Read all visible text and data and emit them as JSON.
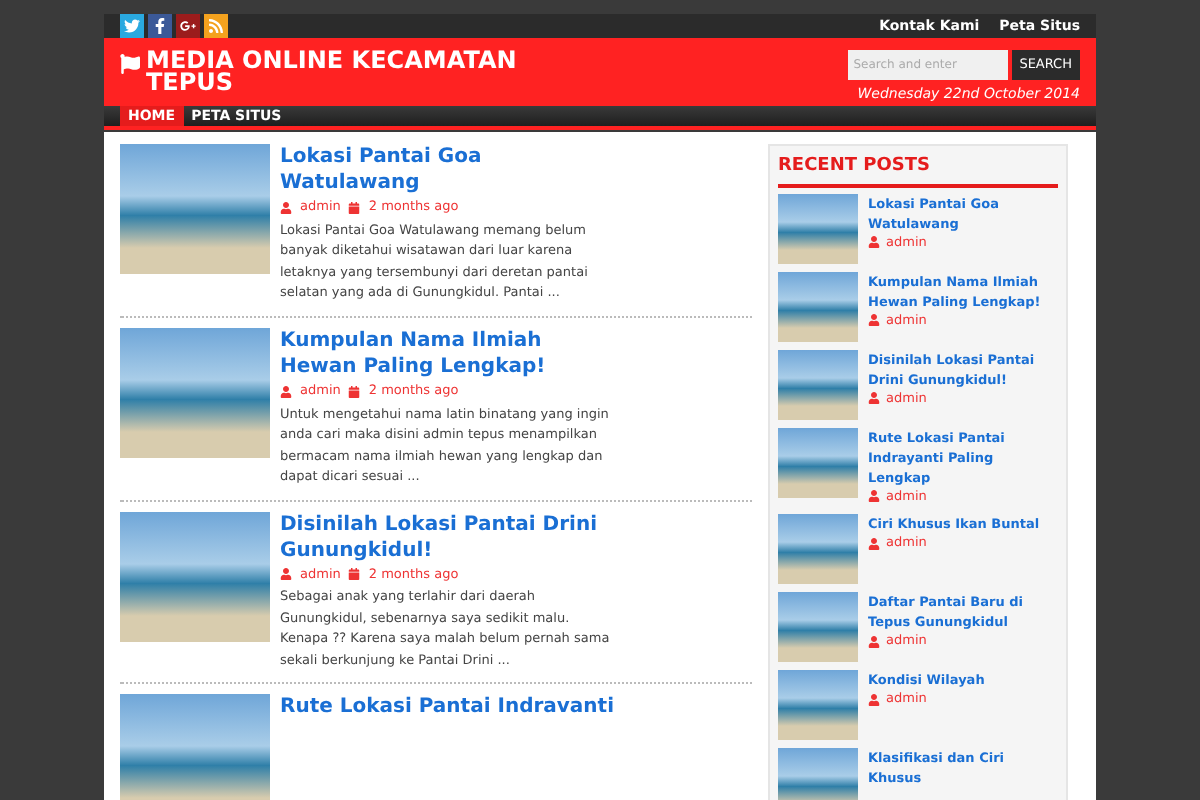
{
  "topbar": {
    "links": [
      "Kontak Kami",
      "Peta Situs"
    ]
  },
  "header": {
    "title": "MEDIA ONLINE KECAMATAN TEPUS",
    "search": {
      "placeholder": "Search and enter",
      "button": "SEARCH"
    },
    "date": "Wednesday 22nd October 2014"
  },
  "nav": [
    {
      "label": "HOME",
      "selected": true
    },
    {
      "label": "PETA SITUS",
      "selected": false
    }
  ],
  "posts": [
    {
      "title": "Lokasi Pantai Goa Watulawang",
      "author": "admin",
      "time": "2 months ago",
      "excerpt": "Lokasi Pantai Goa Watulawang memang belum banyak diketahui wisatawan dari luar karena letaknya yang tersembunyi dari deretan pantai selatan yang ada di Gunungkidul. Pantai ..."
    },
    {
      "title": "Kumpulan Nama Ilmiah Hewan Paling Lengkap!",
      "author": "admin",
      "time": "2 months ago",
      "excerpt": "Untuk mengetahui nama latin binatang yang ingin anda cari maka disini admin tepus menampilkan bermacam nama ilmiah hewan yang lengkap dan dapat dicari sesuai ..."
    },
    {
      "title": "Disinilah Lokasi Pantai Drini Gunungkidul!",
      "author": "admin",
      "time": "2 months ago",
      "excerpt": "Sebagai anak yang terlahir dari daerah Gunungkidul, sebenarnya saya sedikit malu. Kenapa ?? Karena saya malah belum pernah sama sekali berkunjung ke Pantai Drini ..."
    },
    {
      "title": "Rute Lokasi Pantai Indravanti"
    }
  ],
  "sidebar": {
    "title": "RECENT POSTS",
    "items": [
      {
        "title": "Lokasi Pantai Goa Watulawang",
        "author": "admin"
      },
      {
        "title": "Kumpulan Nama Ilmiah Hewan Paling Lengkap!",
        "author": "admin"
      },
      {
        "title": "Disinilah Lokasi Pantai Drini Gunungkidul!",
        "author": "admin"
      },
      {
        "title": "Rute Lokasi Pantai Indrayanti Paling Lengkap",
        "author": "admin"
      },
      {
        "title": "Ciri Khusus Ikan Buntal",
        "author": "admin"
      },
      {
        "title": "Daftar Pantai Baru di Tepus Gunungkidul",
        "author": "admin"
      },
      {
        "title": "Kondisi Wilayah",
        "author": "admin"
      },
      {
        "title": "Klasifikasi dan Ciri Khusus"
      }
    ]
  }
}
